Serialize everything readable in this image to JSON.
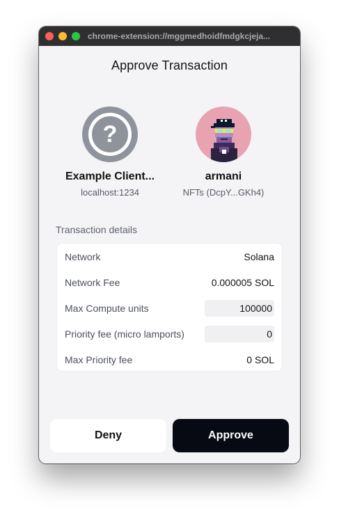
{
  "window": {
    "url": "chrome-extension://mggmedhoidfmdgkcjeja..."
  },
  "header": {
    "title": "Approve Transaction"
  },
  "client": {
    "name": "Example Client...",
    "origin": "localhost:1234",
    "icon": "question-mark-icon"
  },
  "wallet": {
    "name": "armani",
    "subtitle": "NFTs (DcpY...GKh4)"
  },
  "details": {
    "label": "Transaction details",
    "rows": [
      {
        "key": "Network",
        "value": "Solana"
      },
      {
        "key": "Network Fee",
        "value": "0.000005 SOL"
      },
      {
        "key": "Max Compute units",
        "value": "100000"
      },
      {
        "key": "Priority fee (micro lamports)",
        "value": "0"
      },
      {
        "key": "Max Priority fee",
        "value": "0 SOL"
      }
    ]
  },
  "actions": {
    "deny": "Deny",
    "approve": "Approve"
  },
  "colors": {
    "approve_bg": "#080a13",
    "avatar_bg": "#e8a3b3",
    "unknown_bg": "#8f939c"
  }
}
